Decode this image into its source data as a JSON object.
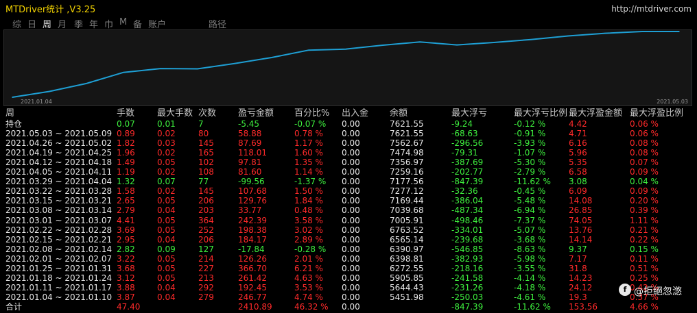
{
  "app": {
    "title": "MTDriver统计 ,V3.25",
    "url": "http://mtdriver.com"
  },
  "menu": [
    "综",
    "日",
    "周",
    "月",
    "季",
    "年",
    "巾",
    "M",
    "备",
    "账户",
    "路径"
  ],
  "active_menu": "周",
  "chart_data": {
    "type": "line",
    "x_start_label": "2021.01.04",
    "x_end_label": "2021.05.03",
    "series": [
      {
        "color": "#1e9fd4",
        "values": [
          5451.98,
          5644.43,
          5905.85,
          6272.55,
          6398.81,
          6390.97,
          6565.14,
          6763.52,
          7005.91,
          7039.68,
          7169.44,
          7277.12,
          7177.56,
          7259.16,
          7356.97,
          7474.98,
          7562.67,
          7621.55,
          7621.55
        ]
      }
    ]
  },
  "table": {
    "headers": [
      "周",
      "手数",
      "最大手数",
      "次数",
      "盈亏金额",
      "百分比%",
      "出入金",
      "余额",
      "最大浮亏",
      "最大浮亏比例",
      "最大浮盈金额",
      "最大浮盈比例"
    ],
    "rows": [
      {
        "cells": [
          "持仓",
          "0.07",
          "0.01",
          "7",
          "-5.45",
          "-0.07 %",
          "0.00",
          "7621.55",
          "-9.24",
          "-0.12 %",
          "4.42",
          "0.06 %"
        ],
        "color": "green"
      },
      {
        "cells": [
          "2021.05.03 ~ 2021.05.09",
          "0.89",
          "0.02",
          "80",
          "58.88",
          "0.78 %",
          "0.00",
          "7621.55",
          "-68.63",
          "-0.91 %",
          "4.71",
          "0.06 %"
        ],
        "color": "red"
      },
      {
        "cells": [
          "2021.04.26 ~ 2021.05.02",
          "1.82",
          "0.03",
          "145",
          "87.69",
          "1.17 %",
          "0.00",
          "7562.67",
          "-296.56",
          "-3.93 %",
          "6.16",
          "0.08 %"
        ],
        "color": "red"
      },
      {
        "cells": [
          "2021.04.19 ~ 2021.04.25",
          "1.96",
          "0.02",
          "165",
          "118.01",
          "1.60 %",
          "0.00",
          "7474.98",
          "-79.31",
          "-1.07 %",
          "5.96",
          "0.08 %"
        ],
        "color": "red"
      },
      {
        "cells": [
          "2021.04.12 ~ 2021.04.18",
          "1.49",
          "0.05",
          "102",
          "97.81",
          "1.35 %",
          "0.00",
          "7356.97",
          "-387.69",
          "-5.30 %",
          "5.35",
          "0.07 %"
        ],
        "color": "red"
      },
      {
        "cells": [
          "2021.04.05 ~ 2021.04.11",
          "1.19",
          "0.02",
          "108",
          "81.60",
          "1.14 %",
          "0.00",
          "7259.16",
          "-202.77",
          "-2.79 %",
          "6.58",
          "0.09 %"
        ],
        "color": "red"
      },
      {
        "cells": [
          "2021.03.29 ~ 2021.04.04",
          "1.32",
          "0.07",
          "77",
          "-99.56",
          "-1.37 %",
          "0.00",
          "7177.56",
          "-847.39",
          "-11.62 %",
          "3.08",
          "0.04 %"
        ],
        "color": "green"
      },
      {
        "cells": [
          "2021.03.22 ~ 2021.03.28",
          "1.58",
          "0.02",
          "145",
          "107.68",
          "1.50 %",
          "0.00",
          "7277.12",
          "-32.36",
          "-0.45 %",
          "6.09",
          "0.09 %"
        ],
        "color": "red"
      },
      {
        "cells": [
          "2021.03.15 ~ 2021.03.21",
          "2.65",
          "0.05",
          "206",
          "129.76",
          "1.84 %",
          "0.00",
          "7169.44",
          "-386.04",
          "-5.48 %",
          "14.08",
          "0.20 %"
        ],
        "color": "red"
      },
      {
        "cells": [
          "2021.03.08 ~ 2021.03.14",
          "2.79",
          "0.04",
          "203",
          "33.77",
          "0.48 %",
          "0.00",
          "7039.68",
          "-487.34",
          "-6.94 %",
          "26.85",
          "0.39 %"
        ],
        "color": "red"
      },
      {
        "cells": [
          "2021.03.01 ~ 2021.03.07",
          "4.41",
          "0.05",
          "364",
          "242.39",
          "3.58 %",
          "0.00",
          "7005.91",
          "-498.46",
          "-7.37 %",
          "74.05",
          "1.11 %"
        ],
        "color": "red"
      },
      {
        "cells": [
          "2021.02.22 ~ 2021.02.28",
          "3.69",
          "0.05",
          "252",
          "198.38",
          "3.02 %",
          "0.00",
          "6763.52",
          "-334.01",
          "-5.07 %",
          "13.76",
          "0.21 %"
        ],
        "color": "red"
      },
      {
        "cells": [
          "2021.02.15 ~ 2021.02.21",
          "2.95",
          "0.04",
          "206",
          "184.17",
          "2.89 %",
          "0.00",
          "6565.14",
          "-239.68",
          "-3.68 %",
          "14.14",
          "0.22 %"
        ],
        "color": "red"
      },
      {
        "cells": [
          "2021.02.08 ~ 2021.02.14",
          "2.82",
          "0.09",
          "127",
          "-17.84",
          "-0.28 %",
          "0.00",
          "6390.97",
          "-546.85",
          "-8.63 %",
          "9.37",
          "0.15 %"
        ],
        "color": "green"
      },
      {
        "cells": [
          "2021.02.01 ~ 2021.02.07",
          "3.22",
          "0.05",
          "214",
          "126.26",
          "2.01 %",
          "0.00",
          "6398.81",
          "-382.93",
          "-5.98 %",
          "7.17",
          "0.11 %"
        ],
        "color": "red"
      },
      {
        "cells": [
          "2021.01.25 ~ 2021.01.31",
          "3.68",
          "0.05",
          "227",
          "366.70",
          "6.21 %",
          "0.00",
          "6272.55",
          "-218.16",
          "-3.55 %",
          "31.8",
          "0.51 %"
        ],
        "color": "red"
      },
      {
        "cells": [
          "2021.01.18 ~ 2021.01.24",
          "3.12",
          "0.05",
          "213",
          "261.42",
          "4.63 %",
          "0.00",
          "5905.85",
          "-241.58",
          "-4.14 %",
          "14.23",
          "0.25 %"
        ],
        "color": "red"
      },
      {
        "cells": [
          "2021.01.11 ~ 2021.01.17",
          "3.88",
          "0.04",
          "292",
          "192.45",
          "3.53 %",
          "0.00",
          "5644.43",
          "-231.26",
          "-4.18 %",
          "24.12",
          "0.42 %"
        ],
        "color": "red"
      },
      {
        "cells": [
          "2021.01.04 ~ 2021.01.10",
          "3.87",
          "0.04",
          "279",
          "246.77",
          "4.74 %",
          "0.00",
          "5451.98",
          "-250.03",
          "-4.61 %",
          "19.3",
          "0.37 %"
        ],
        "color": "red"
      },
      {
        "cells": [
          "合计",
          "47.40",
          "",
          "",
          "2410.89",
          "46.32 %",
          "0.00",
          "",
          "-847.39",
          "-11.62 %",
          "153.56",
          "4.66 %"
        ],
        "color": "red"
      }
    ]
  },
  "watermark": {
    "logo": "f",
    "text": "@拒絕忽滺"
  }
}
